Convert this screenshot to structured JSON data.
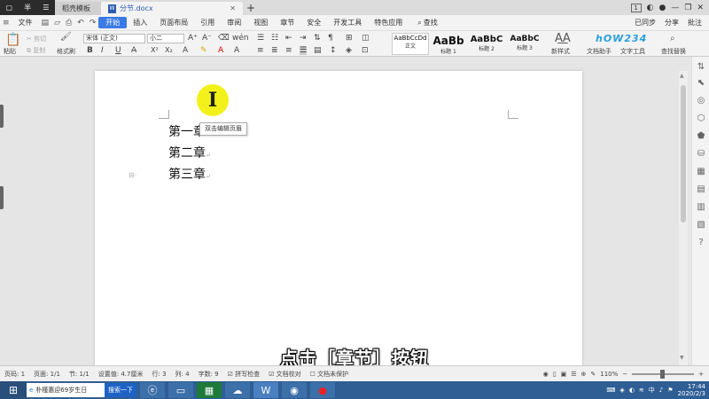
{
  "titlebar": {
    "recorder_glyph": "半",
    "tabs": [
      {
        "label": "稻壳模板",
        "active": false
      },
      {
        "label": "分节.docx",
        "active": true
      }
    ],
    "page_count_badge": "1"
  },
  "menubar": {
    "file_label": "文件",
    "items": [
      "开始",
      "插入",
      "页面布局",
      "引用",
      "审阅",
      "视图",
      "章节",
      "安全",
      "开发工具",
      "特色应用"
    ],
    "active_item": "开始",
    "search_label": "查找",
    "right": [
      "已同步",
      "分享",
      "批注"
    ]
  },
  "ribbon": {
    "paste_label": "粘贴",
    "cut_label": "剪切",
    "copy_label": "复制",
    "format_painter_label": "格式刷",
    "font_name": "宋体 (正文)",
    "font_size": "小二",
    "styles": [
      {
        "sample": "AaBbCcDd",
        "label": "正文"
      },
      {
        "sample": "AaBb",
        "label": "标题 1"
      },
      {
        "sample": "AaBbC",
        "label": "标题 2"
      },
      {
        "sample": "AaBbC",
        "label": "标题 3"
      }
    ],
    "new_style_label": "新样式",
    "doc_assistant_label": "文档助手",
    "text_tool_label": "文字工具",
    "find_replace_label": "查找替换",
    "logo_text": "hOW234"
  },
  "document": {
    "chapters": [
      "第一章",
      "第二章",
      "第三章"
    ],
    "tooltip": "双击编辑页眉",
    "cursor_glyph": "I"
  },
  "caption": "点击［章节］按钮",
  "statusbar": {
    "page_num": "页码: 1",
    "page": "页面: 1/1",
    "section": "节: 1/1",
    "setting": "设置值: 4.7厘米",
    "row": "行: 3",
    "col": "列: 4",
    "word_count": "字数: 9",
    "spell_check": "拼写检查",
    "doc_proof": "文档校对",
    "doc_unprotected": "文档未保护",
    "zoom": "110%"
  },
  "taskbar": {
    "search_text": "朴槿惠迎69岁生日",
    "search_button": "搜索一下",
    "ime": "中",
    "time": "17:44",
    "date": "2020/2/3"
  }
}
